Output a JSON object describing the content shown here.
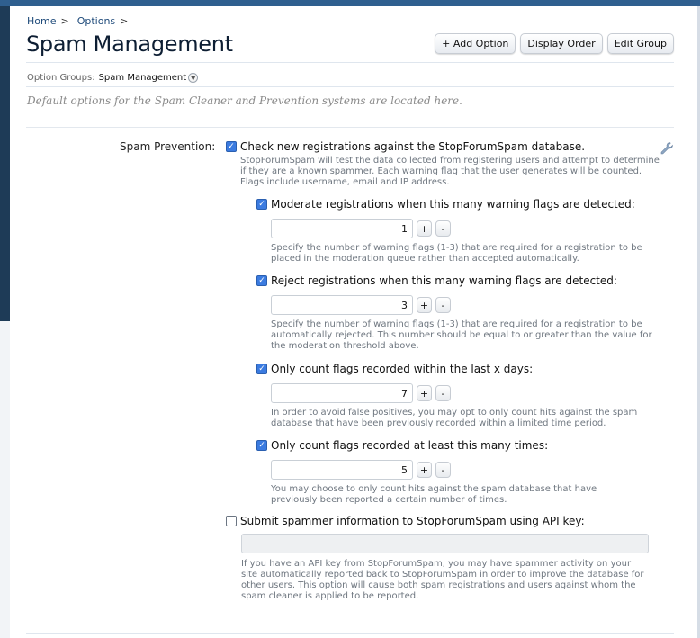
{
  "breadcrumb": {
    "items": [
      "Home",
      "Options"
    ],
    "separator": ">"
  },
  "page": {
    "title": "Spam Management",
    "buttons": {
      "add_option": "+ Add Option",
      "display_order": "Display Order",
      "edit_group": "Edit Group"
    },
    "option_groups_label": "Option Groups:",
    "option_groups_value": "Spam Management",
    "description": "Default options for the Spam Cleaner and Prevention systems are located here."
  },
  "spam_prevention": {
    "label": "Spam Prevention:",
    "main": {
      "checked": true,
      "label": "Check new registrations against the StopForumSpam database.",
      "hint": "StopForumSpam will test the data collected from registering users and attempt to determine if they are a known spammer. Each warning flag that the user generates will be counted. Flags include username, email and IP address."
    },
    "moderate": {
      "checked": true,
      "label": "Moderate registrations when this many warning flags are detected:",
      "value": "1",
      "hint": "Specify the number of warning flags (1-3) that are required for a registration to be placed in the moderation queue rather than accepted automatically."
    },
    "reject": {
      "checked": true,
      "label": "Reject registrations when this many warning flags are detected:",
      "value": "3",
      "hint": "Specify the number of warning flags (1-3) that are required for a registration to be automatically rejected. This number should be equal to or greater than the value for the moderation threshold above."
    },
    "days": {
      "checked": true,
      "label": "Only count flags recorded within the last x days:",
      "value": "7",
      "hint": "In order to avoid false positives, you may opt to only count hits against the spam database that have been previously recorded within a limited time period."
    },
    "times": {
      "checked": true,
      "label": "Only count flags recorded at least this many times:",
      "value": "5",
      "hint": "You may choose to only count hits against the spam database that have previously been reported a certain number of times."
    },
    "api": {
      "checked": false,
      "label": "Submit spammer information to StopForumSpam using API key:",
      "value": "",
      "hint": "If you have an API key from StopForumSpam, you may have spammer activity on your site automatically reported back to StopForumSpam in order to improve the database for other users. This option will cause both spam registrations and users against whom the spam cleaner is applied to be reported."
    },
    "stepper_plus": "+",
    "stepper_minus": "-"
  },
  "icons": {
    "wrench": "wrench-icon",
    "dropdown": "chevron-down-icon",
    "check": "check-icon"
  }
}
